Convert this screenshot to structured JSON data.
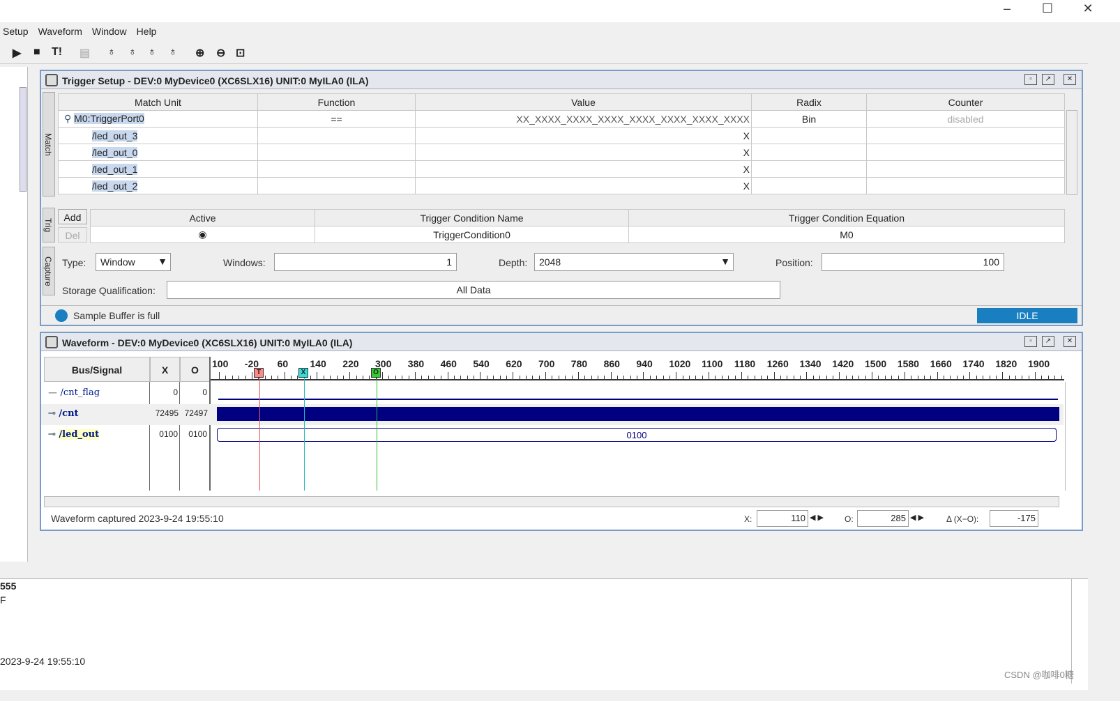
{
  "window": {
    "minimize": "–",
    "maximize": "☐",
    "close": "✕"
  },
  "menu": [
    "Setup",
    "Waveform",
    "Window",
    "Help"
  ],
  "toolbar": {
    "run": "▶",
    "stop": "■",
    "trigger_immediate": "T!"
  },
  "trigger_panel": {
    "title": "Trigger Setup - DEV:0 MyDevice0 (XC6SLX16) UNIT:0 MyILA0 (ILA)",
    "side_tabs": {
      "match": "Match",
      "trig": "Trig",
      "capture": "Capture"
    },
    "match_columns": [
      "Match Unit",
      "Function",
      "Value",
      "Radix",
      "Counter"
    ],
    "match_rows": [
      {
        "unit": "M0:TriggerPort0",
        "function": "==",
        "value": "XX_XXXX_XXXX_XXXX_XXXX_XXXX_XXXX_XXXX",
        "radix": "Bin",
        "counter": "disabled"
      },
      {
        "unit": "/led_out_3",
        "value": "X"
      },
      {
        "unit": "/led_out_0",
        "value": "X"
      },
      {
        "unit": "/led_out_1",
        "value": "X"
      },
      {
        "unit": "/led_out_2",
        "value": "X"
      }
    ],
    "add_label": "Add",
    "del_label": "Del",
    "trig_columns": [
      "Active",
      "Trigger Condition Name",
      "Trigger Condition Equation"
    ],
    "trig_row": {
      "name": "TriggerCondition0",
      "equation": "M0"
    },
    "type_label": "Type:",
    "type_value": "Window",
    "windows_label": "Windows:",
    "windows_value": "1",
    "depth_label": "Depth:",
    "depth_value": "2048",
    "position_label": "Position:",
    "position_value": "100",
    "storage_label": "Storage Qualification:",
    "storage_value": "All Data",
    "status_text": "Sample Buffer is full",
    "status_badge": "IDLE",
    "status_color": "#1a7fc0"
  },
  "waveform_panel": {
    "title": "Waveform - DEV:0 MyDevice0 (XC6SLX16) UNIT:0 MyILA0 (ILA)",
    "columns": [
      "Bus/Signal",
      "X",
      "O"
    ],
    "ruler": [
      "100",
      "-20",
      "60",
      "140",
      "220",
      "300",
      "380",
      "460",
      "540",
      "620",
      "700",
      "780",
      "860",
      "940",
      "1020",
      "1100",
      "1180",
      "1260",
      "1340",
      "1420",
      "1500",
      "1580",
      "1660",
      "1740",
      "1820",
      "1900"
    ],
    "markers": {
      "t": "T",
      "x": "X",
      "o": "O"
    },
    "signals": [
      {
        "name": "/cnt_flag",
        "x": "0",
        "o": "0"
      },
      {
        "name": "/cnt",
        "x": "72495",
        "o": "72497"
      },
      {
        "name": "/led_out",
        "x": "0100",
        "o": "0100",
        "bus_value": "0100"
      }
    ],
    "captured": "Waveform captured 2023-9-24 19:55:10",
    "x_label": "X:",
    "x_value": "110",
    "o_label": "O:",
    "o_value": "285",
    "delta_label": "Δ (X−O):",
    "delta_value": "-175"
  },
  "console": {
    "lines": [
      "555",
      "F",
      "2023-9-24 19:55:10"
    ]
  },
  "watermark": "CSDN @咖啡0糖"
}
